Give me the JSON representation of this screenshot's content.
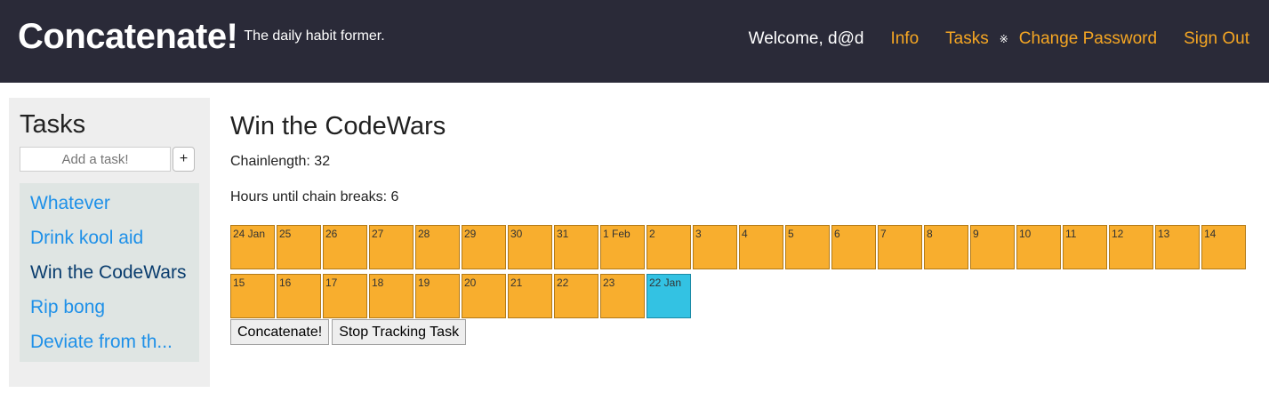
{
  "header": {
    "brand": "Concatenate!",
    "tagline": "The daily habit former.",
    "welcome": "Welcome, d@d",
    "nav": {
      "info": "Info",
      "tasks": "Tasks",
      "separator": "※",
      "change_password": "Change Password",
      "sign_out": "Sign Out"
    },
    "accent_color": "#f5a623"
  },
  "sidebar": {
    "title": "Tasks",
    "add_placeholder": "Add a task!",
    "add_button": "+",
    "items": [
      {
        "label": "Whatever",
        "active": false
      },
      {
        "label": "Drink kool aid",
        "active": false
      },
      {
        "label": "Win the CodeWars",
        "active": true
      },
      {
        "label": "Rip bong",
        "active": false
      },
      {
        "label": "Deviate from th...",
        "active": false
      }
    ]
  },
  "main": {
    "title": "Win the CodeWars",
    "chainlength_label": "Chainlength: 32",
    "hours_label": "Hours until chain breaks: 6",
    "days": [
      "24 Jan",
      "25",
      "26",
      "27",
      "28",
      "29",
      "30",
      "31",
      "1 Feb",
      "2",
      "3",
      "4",
      "5",
      "6",
      "7",
      "8",
      "9",
      "10",
      "11",
      "12",
      "13",
      "14",
      "15",
      "16",
      "17",
      "18",
      "19",
      "20",
      "21",
      "22",
      "23",
      "22 Jan"
    ],
    "today_label": "22 Jan",
    "chain_color": "#f8ae2e",
    "today_color": "#33c2e3",
    "buttons": {
      "concatenate": "Concatenate!",
      "stop": "Stop Tracking Task"
    }
  }
}
